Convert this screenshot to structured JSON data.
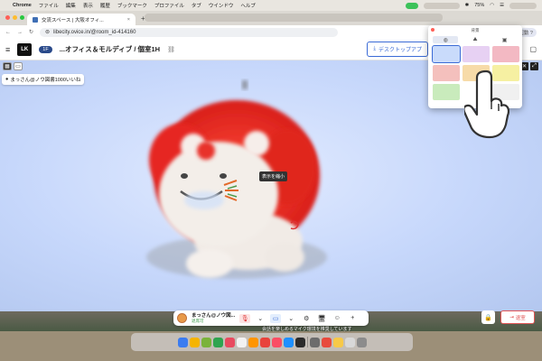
{
  "menubar": {
    "app": "Chrome",
    "items": [
      "ファイル",
      "編集",
      "表示",
      "履歴",
      "ブックマーク",
      "プロファイル",
      "タブ",
      "ウインドウ",
      "ヘルプ"
    ],
    "battery": "75%"
  },
  "browser": {
    "tab_title": "交流スペース | 大阪オフィ...",
    "url": "libecity.ovice.in/@room_id-414160",
    "extension_label": "再起動 ?"
  },
  "app": {
    "floor_badge": "1F",
    "breadcrumb": "...オフィス＆モルディブ / 個室1H",
    "desktop_button": "デスクトップアプ"
  },
  "stage": {
    "name_chip": "まっさん@ノウ図書1000いいね",
    "tooltip": "表示を縮小",
    "background_color": "#c6d7fb"
  },
  "bg_picker": {
    "title": "背景",
    "swatch_colors": [
      "#c9dbfb",
      "#e7d1f3",
      "#f3b9c3",
      "#f4c0bd",
      "#f7dba8",
      "#f6f0a2",
      "#c9ebbc",
      "#ffffff",
      "#f0f0f0"
    ],
    "selected_index": 0
  },
  "controls": {
    "user_name": "まっさん@ノウ図...",
    "user_status": "退席可",
    "leave_label": "退室"
  },
  "bottom_notice": "会話を楽しめるマイク環境を推奨しています",
  "dock_colors": [
    "#3b7cf0",
    "#f5b400",
    "#7ab33a",
    "#2ea44f",
    "#e84a5f",
    "#f2f2f2",
    "#ff9500",
    "#e8433c",
    "#fa4e64",
    "#1e90ff",
    "#2b2b2b",
    "#6c6c6c",
    "#e84a3c",
    "#f7c948",
    "#d8d8d8",
    "#8c8c8c"
  ]
}
